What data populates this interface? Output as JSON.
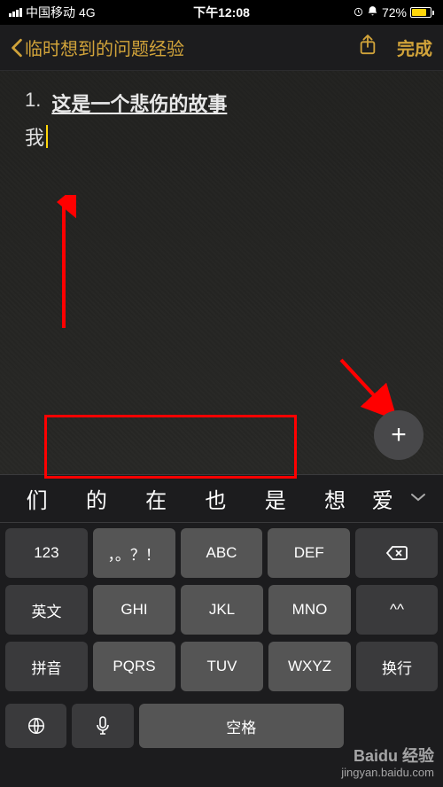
{
  "status_bar": {
    "carrier": "中国移动",
    "network": "4G",
    "time": "下午12:08",
    "lock_icon": "lock",
    "alarm_icon": "alarm",
    "battery_percent": "72%"
  },
  "nav": {
    "back_title": "临时想到的问题经验",
    "share_icon": "share",
    "done_label": "完成"
  },
  "note": {
    "list_number": "1.",
    "title": "这是一个悲伤的故事",
    "body_text": "我"
  },
  "plus_button": "+",
  "keyboard": {
    "suggestions": [
      "们",
      "的",
      "在",
      "也",
      "是",
      "想",
      "爱"
    ],
    "row1": [
      "123",
      "，。？！",
      "ABC",
      "DEF"
    ],
    "row2": [
      "英文",
      "GHI",
      "JKL",
      "MNO",
      "^^"
    ],
    "row3": [
      "拼音",
      "PQRS",
      "TUV",
      "WXYZ"
    ],
    "enter_label": "换行",
    "space_label": "空格",
    "globe_icon": "globe",
    "mic_icon": "mic",
    "delete_icon": "delete"
  },
  "watermark": {
    "brand": "Baidu 经验",
    "url": "jingyan.baidu.com"
  }
}
